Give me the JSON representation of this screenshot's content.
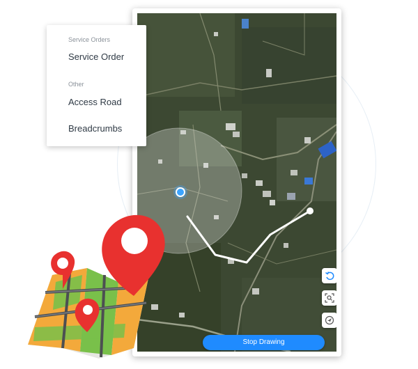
{
  "menu": {
    "sections": [
      {
        "label": "Service Orders",
        "items": [
          "Service Order"
        ]
      },
      {
        "label": "Other",
        "items": [
          "Access Road",
          "Breadcrumbs"
        ]
      }
    ]
  },
  "map": {
    "stop_button_label": "Stop Drawing",
    "controls": [
      "undo-icon",
      "zoom-to-fit-icon",
      "locate-icon"
    ],
    "accent_color": "#1f8bff",
    "location_color": "#3ba4ff"
  },
  "illustration": {
    "icons": [
      "folded-map-icon",
      "map-pin-icon"
    ],
    "pin_color": "#e8312f"
  }
}
